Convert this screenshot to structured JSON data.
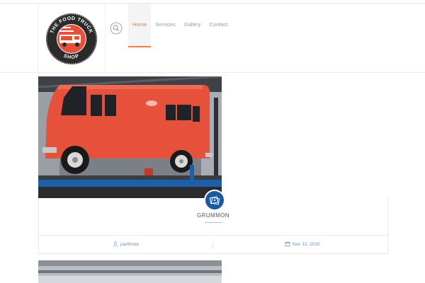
{
  "logo": {
    "text_top": "THE FOOD TRUCK",
    "text_bottom": "SHOP"
  },
  "nav": {
    "items": [
      {
        "label": "Home"
      },
      {
        "label": "Services"
      },
      {
        "label": "Gallery"
      },
      {
        "label": "Contact"
      }
    ]
  },
  "post": {
    "title": "GRUMMON",
    "author": "partthree",
    "date": "Nov 12, 2015"
  },
  "colors": {
    "accent": "#f07c41",
    "icon_blue": "#1b5aa0",
    "truck_red": "#e8503a",
    "meta_link": "#6a8eb4"
  },
  "icons": {
    "search": "search-icon",
    "post_type": "gallery-icon",
    "author": "user-icon",
    "date": "calendar-icon"
  }
}
